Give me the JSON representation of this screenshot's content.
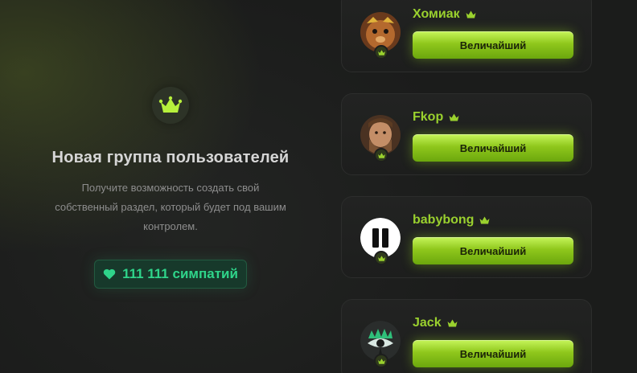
{
  "promo": {
    "icon": "crown-icon",
    "title": "Новая группа пользователей",
    "description": "Получите возможность создать свой собственный раздел, который будет под вашим контролем.",
    "likes_icon": "heart-icon",
    "likes_text": "111 111 симпатий"
  },
  "users": [
    {
      "name": "Хомиак",
      "rank": "Величайший",
      "avatar": "hamster-avatar"
    },
    {
      "name": "Fkop",
      "rank": "Величайший",
      "avatar": "bearded-man-avatar"
    },
    {
      "name": "babybong",
      "rank": "Величайший",
      "avatar": "pause-avatar"
    },
    {
      "name": "Jack",
      "rank": "Величайший",
      "avatar": "eye-avatar"
    }
  ],
  "colors": {
    "accent": "#9ad12e",
    "likes": "#2fd48a",
    "background": "#1b1c1b"
  }
}
